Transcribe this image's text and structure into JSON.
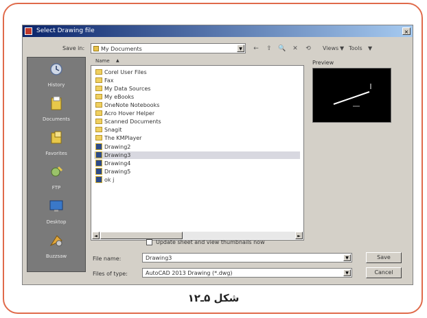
{
  "dialog": {
    "title": "Select Drawing file",
    "close_glyph": "×",
    "look_in_label": "Save in:",
    "look_in_value": "My Documents",
    "toolbar": {
      "back": "←",
      "up": "⇧",
      "search": "🔍",
      "delete": "✕",
      "new_folder": "⟲",
      "views_label": "Views",
      "tools_label": "Tools"
    },
    "places": [
      {
        "label": "History",
        "icon": "history-icon"
      },
      {
        "label": "Documents",
        "icon": "documents-icon"
      },
      {
        "label": "Favorites",
        "icon": "favorites-icon"
      },
      {
        "label": "FTP",
        "icon": "ftp-icon"
      },
      {
        "label": "Desktop",
        "icon": "desktop-icon"
      },
      {
        "label": "Buzzsaw",
        "icon": "buzzsaw-icon"
      }
    ],
    "file_list": {
      "column_header": "Name",
      "items": [
        {
          "name": "Corel User Files",
          "type": "folder"
        },
        {
          "name": "Fax",
          "type": "folder"
        },
        {
          "name": "My Data Sources",
          "type": "folder"
        },
        {
          "name": "My eBooks",
          "type": "folder"
        },
        {
          "name": "OneNote Notebooks",
          "type": "folder"
        },
        {
          "name": "Acro Hover Helper",
          "type": "folder"
        },
        {
          "name": "Scanned Documents",
          "type": "folder"
        },
        {
          "name": "Snagit",
          "type": "folder"
        },
        {
          "name": "The KMPlayer",
          "type": "folder"
        },
        {
          "name": "Drawing2",
          "type": "drawing"
        },
        {
          "name": "Drawing3",
          "type": "drawing",
          "selected": true
        },
        {
          "name": "Drawing4",
          "type": "drawing"
        },
        {
          "name": "Drawing5",
          "type": "drawing"
        },
        {
          "name": "ok j",
          "type": "drawing"
        }
      ]
    },
    "preview_label": "Preview",
    "update_checkbox_label": "Update sheet and view thumbnails now",
    "file_name_label": "File name:",
    "file_name_value": "Drawing3",
    "file_type_label": "Files of type:",
    "file_type_value": "AutoCAD 2013 Drawing (*.dwg)",
    "save_button": "Save",
    "cancel_button": "Cancel"
  },
  "caption": "شکل ۵ـ۱۲",
  "colors": {
    "frame_border": "#e06a4a",
    "dialog_bg": "#d4d0c8",
    "places_bg": "#7a7a7a"
  }
}
